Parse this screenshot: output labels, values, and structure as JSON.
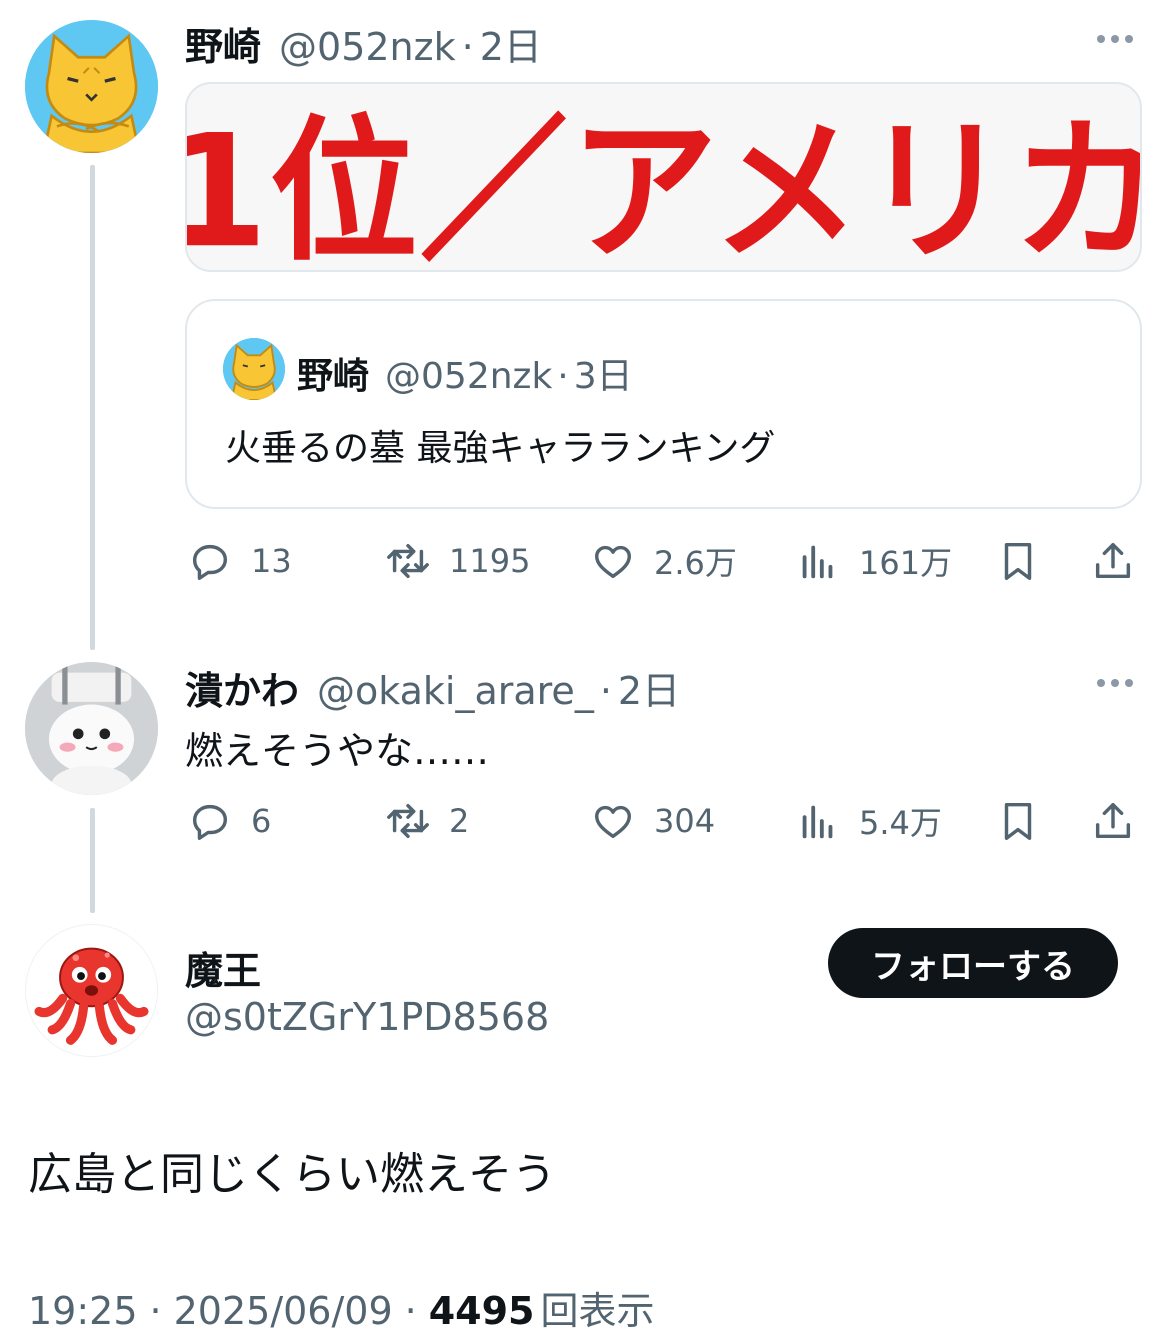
{
  "tweet1": {
    "name": "野崎",
    "handle": "@052nzk",
    "dot": "·",
    "time": "2日",
    "banner_text": "1位／アメリカ",
    "quote": {
      "name": "野崎",
      "handle": "@052nzk",
      "dot": "·",
      "time": "3日",
      "text": "火垂るの墓 最強キャラランキング"
    },
    "actions": {
      "replies": "13",
      "retweets": "1195",
      "likes": "2.6万",
      "views": "161万"
    }
  },
  "tweet2": {
    "name": "潰かわ",
    "handle": "@okaki_arare_",
    "dot": "·",
    "time": "2日",
    "text": "燃えそうやな……",
    "actions": {
      "replies": "6",
      "retweets": "2",
      "likes": "304",
      "views": "5.4万"
    }
  },
  "main_tweet": {
    "name": "魔王",
    "handle": "@s0tZGrY1PD8568",
    "follow_label": "フォローする",
    "text": "広島と同じくらい燃えそう",
    "time": "19:25",
    "sep1": "·",
    "date": "2025/06/09",
    "sep2": "·",
    "views_count": "4495",
    "views_label": "回表示"
  },
  "icons": {
    "reply": "reply-icon",
    "retweet": "retweet-icon",
    "like": "heart-icon",
    "views": "views-icon",
    "bookmark": "bookmark-icon",
    "share": "share-icon",
    "more": "more-icon"
  },
  "colors": {
    "accent_red": "#e01a1a",
    "text_primary": "#0f1419",
    "text_secondary": "#536471",
    "thread_line": "#cfd9de"
  }
}
